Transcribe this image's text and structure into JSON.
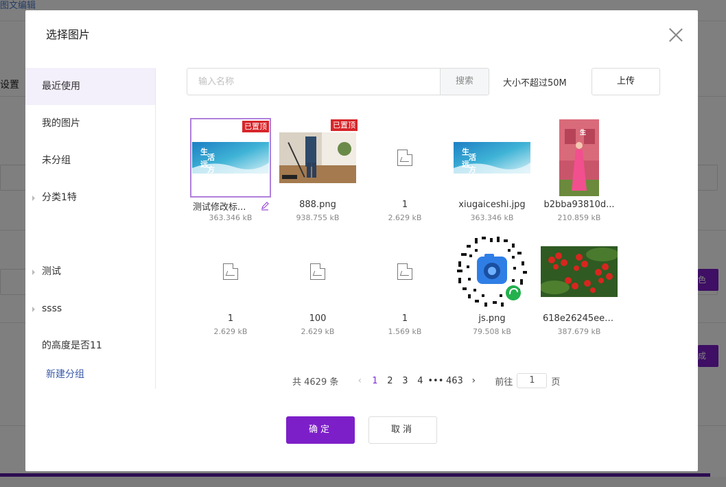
{
  "background": {
    "top_text": "图文编辑",
    "side_text": "设置",
    "btn_1_text": "色",
    "btn_2_text": "成"
  },
  "dialog": {
    "title": "选择图片",
    "sidebar": {
      "items": [
        {
          "label": "最近使用",
          "active": true,
          "caret": false
        },
        {
          "label": "我的图片",
          "active": false,
          "caret": false
        },
        {
          "label": "未分组",
          "active": false,
          "caret": false
        },
        {
          "label": "分类1特",
          "active": false,
          "caret": true
        },
        {
          "label": "测试",
          "active": false,
          "caret": true
        },
        {
          "label": "ssss",
          "active": false,
          "caret": true
        },
        {
          "label": "的高度是否11",
          "active": false,
          "caret": false
        }
      ],
      "new_group": "新建分组"
    },
    "search": {
      "placeholder": "输入名称",
      "value": "",
      "button": "搜索"
    },
    "size_hint": "大小不超过50M",
    "upload_button": "上传",
    "images": [
      {
        "name": "测试修改标...",
        "size": "363.346 kB",
        "pinned": true,
        "pin_label": "已置顶",
        "thumb": "banner"
      },
      {
        "name": "888.png",
        "size": "938.755 kB",
        "pinned": true,
        "pin_label": "已置顶",
        "thumb": "vacuum"
      },
      {
        "name": "1",
        "size": "2.629 kB",
        "pinned": false,
        "thumb": "broken"
      },
      {
        "name": "xiugaiceshi.jpg",
        "size": "363.346 kB",
        "pinned": false,
        "thumb": "banner"
      },
      {
        "name": "b2bba93810d...",
        "size": "210.859 kB",
        "pinned": false,
        "thumb": "pink"
      },
      {
        "name": "1",
        "size": "2.629 kB",
        "pinned": false,
        "thumb": "broken"
      },
      {
        "name": "100",
        "size": "2.629 kB",
        "pinned": false,
        "thumb": "broken"
      },
      {
        "name": "1",
        "size": "1.569 kB",
        "pinned": false,
        "thumb": "broken"
      },
      {
        "name": "js.png",
        "size": "79.508 kB",
        "pinned": false,
        "thumb": "qr"
      },
      {
        "name": "618e26245eef...",
        "size": "387.679 kB",
        "pinned": false,
        "thumb": "berries"
      }
    ],
    "banner_text": {
      "line1": "生",
      "line2": "活",
      "line3": "远",
      "line4": "方"
    },
    "pagination": {
      "total": "共 4629 条",
      "prev": "‹",
      "pages": [
        "1",
        "2",
        "3",
        "4"
      ],
      "active_page": "1",
      "dots": "•••",
      "last": "463",
      "next": "›",
      "goto_prefix": "前往",
      "goto_value": "1",
      "goto_suffix": "页"
    },
    "confirm_button": "确定",
    "cancel_button": "取消"
  }
}
